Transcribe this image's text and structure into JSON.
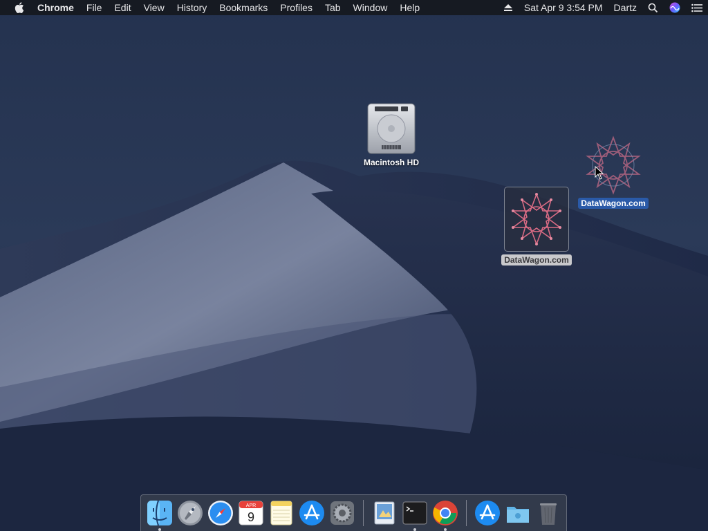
{
  "menubar": {
    "app_name": "Chrome",
    "menus": [
      "File",
      "Edit",
      "View",
      "History",
      "Bookmarks",
      "Profiles",
      "Tab",
      "Window",
      "Help"
    ],
    "clock": "Sat Apr 9  3:54 PM",
    "user": "Dartz",
    "icons": [
      "apple-icon",
      "eject-icon",
      "spotlight-search-icon",
      "siri-icon",
      "notification-center-icon"
    ]
  },
  "desktop": {
    "macintosh_hd_label": "Macintosh HD",
    "datawagon_drag_label": "DataWagon.com",
    "datawagon_label": "DataWagon.com"
  },
  "dock": {
    "calendar_month": "APR",
    "calendar_day": "9",
    "apps": [
      "finder",
      "launchpad",
      "safari",
      "calendar",
      "notes",
      "app-store",
      "system-preferences",
      "preview",
      "terminal",
      "chrome",
      "app-store-downloads",
      "folder",
      "trash"
    ],
    "running": [
      "finder",
      "terminal",
      "chrome"
    ]
  },
  "colors": {
    "selection_blue": "#2a5aa8",
    "menubar_bg": "#16181e",
    "wallpaper_sky": "#1b2642"
  }
}
